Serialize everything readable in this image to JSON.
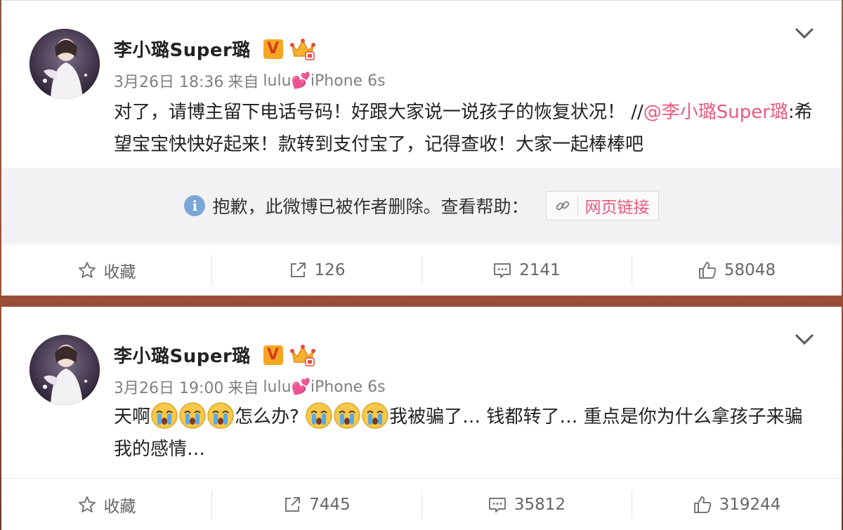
{
  "posts": [
    {
      "username": "李小璐Super璐",
      "verified_badge": "V",
      "date": "3月26日 18:36",
      "source_prefix": "来自",
      "source": "lulu💕iPhone 6s",
      "content_prefix": "对了，请博主留下电话号码！好跟大家说一说孩子的恢复状况！ //",
      "mention": "@李小璐Super璐",
      "content_suffix": ":希望宝宝快快好起来！款转到支付宝了，记得查收！大家一起棒棒吧",
      "deleted_notice": "抱歉，此微博已被作者删除。查看帮助：",
      "help_link": "网页链接",
      "actions": {
        "favorite": "收藏",
        "repost": "126",
        "comment": "2141",
        "like": "58048"
      }
    },
    {
      "username": "李小璐Super璐",
      "verified_badge": "V",
      "date": "3月26日 19:00",
      "source_prefix": "来自",
      "source": "lulu💕iPhone 6s",
      "content_part1": "天啊",
      "content_part2": "怎么办?",
      "content_part3": "我被骗了… 钱都转了… 重点是你为什么拿孩子来骗我的感情…",
      "actions": {
        "favorite": "收藏",
        "repost": "7445",
        "comment": "35812",
        "like": "319244"
      }
    }
  ],
  "colors": {
    "mention": "#eb5a7c",
    "meta": "#808080",
    "panel": "#f2f2f5"
  }
}
